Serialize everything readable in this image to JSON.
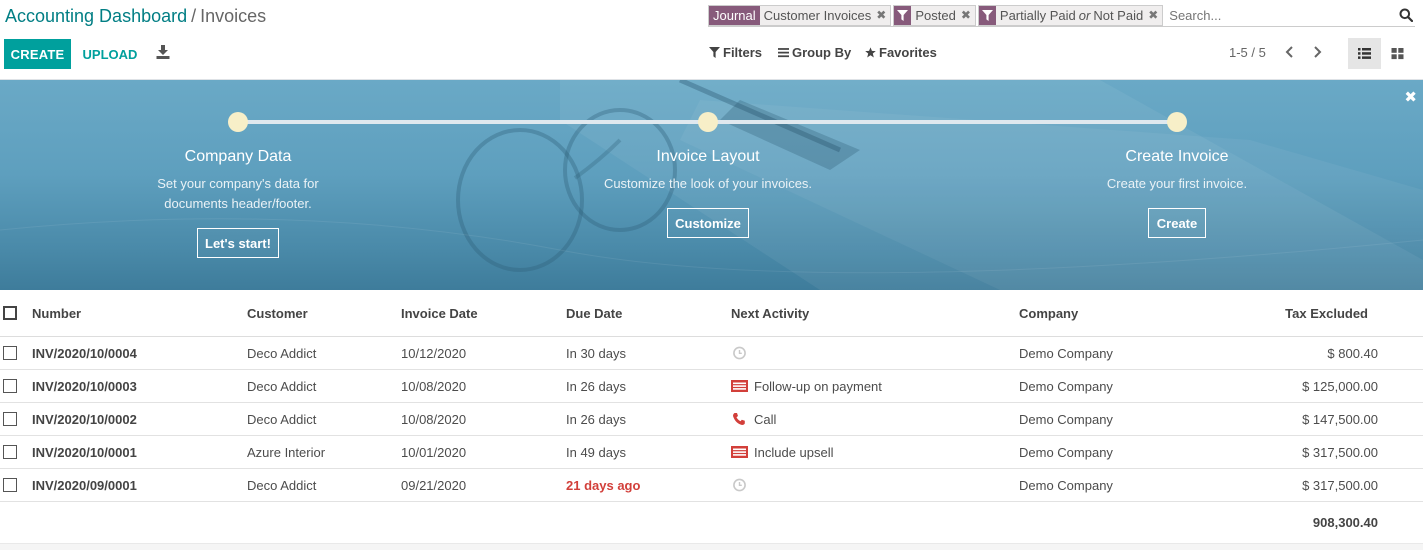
{
  "breadcrumb": {
    "parent": "Accounting Dashboard",
    "separator": "/",
    "current": "Invoices"
  },
  "search": {
    "facets": [
      {
        "label": "Journal",
        "value": "Customer Invoices",
        "type": "field"
      },
      {
        "label": "filter",
        "value": "Posted",
        "type": "filter"
      },
      {
        "label": "filter",
        "value_parts": [
          "Partially Paid",
          "or",
          "Not Paid"
        ],
        "type": "filter"
      }
    ],
    "placeholder": "Search..."
  },
  "toolbar": {
    "create_label": "CREATE",
    "upload_label": "UPLOAD"
  },
  "filters": {
    "filters_label": "Filters",
    "groupby_label": "Group By",
    "favorites_label": "Favorites"
  },
  "pager": {
    "value": "1-5 / 5"
  },
  "banner": {
    "steps": [
      {
        "title": "Company Data",
        "desc_lines": [
          "Set your company's data for",
          "documents header/footer."
        ],
        "button": "Let's start!"
      },
      {
        "title": "Invoice Layout",
        "desc_lines": [
          "Customize the look of your invoices."
        ],
        "button": "Customize"
      },
      {
        "title": "Create Invoice",
        "desc_lines": [
          "Create your first invoice."
        ],
        "button": "Create"
      }
    ]
  },
  "table": {
    "columns": [
      "Number",
      "Customer",
      "Invoice Date",
      "Due Date",
      "Next Activity",
      "Company",
      "Tax Excluded"
    ],
    "rows": [
      {
        "number": "INV/2020/10/0004",
        "customer": "Deco Addict",
        "invoice_date": "10/12/2020",
        "due_date": "In 30 days",
        "due_late": false,
        "activity_icon": "clock-icon",
        "activity": "",
        "company": "Demo Company",
        "amount": "$ 800.40"
      },
      {
        "number": "INV/2020/10/0003",
        "customer": "Deco Addict",
        "invoice_date": "10/08/2020",
        "due_date": "In 26 days",
        "due_late": false,
        "activity_icon": "email-activity-icon",
        "activity": "Follow-up on payment",
        "company": "Demo Company",
        "amount": "$ 125,000.00"
      },
      {
        "number": "INV/2020/10/0002",
        "customer": "Deco Addict",
        "invoice_date": "10/08/2020",
        "due_date": "In 26 days",
        "due_late": false,
        "activity_icon": "phone-icon",
        "activity": "Call",
        "company": "Demo Company",
        "amount": "$ 147,500.00"
      },
      {
        "number": "INV/2020/10/0001",
        "customer": "Azure Interior",
        "invoice_date": "10/01/2020",
        "due_date": "In 49 days",
        "due_late": false,
        "activity_icon": "email-activity-icon",
        "activity": "Include upsell",
        "company": "Demo Company",
        "amount": "$ 317,500.00"
      },
      {
        "number": "INV/2020/09/0001",
        "customer": "Deco Addict",
        "invoice_date": "09/21/2020",
        "due_date": "21 days ago",
        "due_late": true,
        "activity_icon": "clock-icon",
        "activity": "",
        "company": "Demo Company",
        "amount": "$ 317,500.00"
      }
    ],
    "total": "908,300.40"
  },
  "colors": {
    "accent": "#00a09d",
    "link": "#017e84",
    "facet": "#875a7b",
    "late": "#d23f3a",
    "activity_red": "#d23f3a"
  }
}
